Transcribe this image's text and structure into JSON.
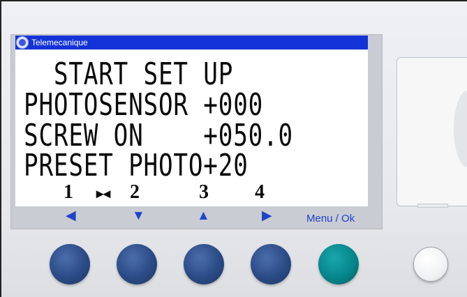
{
  "brand": {
    "name": "Telemecanique",
    "logo_icon": "telemecanique-logo-icon"
  },
  "lcd": {
    "lines": [
      "  START SET UP",
      "PHOTOSENSOR +000",
      "SCREW ON    +050.0",
      "PRESET PHOTO+20"
    ],
    "key_numbers": [
      "1",
      "2",
      "3",
      "4"
    ],
    "mark": "▸◂"
  },
  "nav": {
    "arrows": [
      "◀",
      "▼",
      "▲",
      "▶"
    ],
    "menu_ok_label": "Menu / Ok"
  },
  "colors": {
    "brand_bar": "#1333d8",
    "arrow_blue": "#1f44c9",
    "button_blue": "#2b4b86",
    "button_ok": "#06858c"
  }
}
